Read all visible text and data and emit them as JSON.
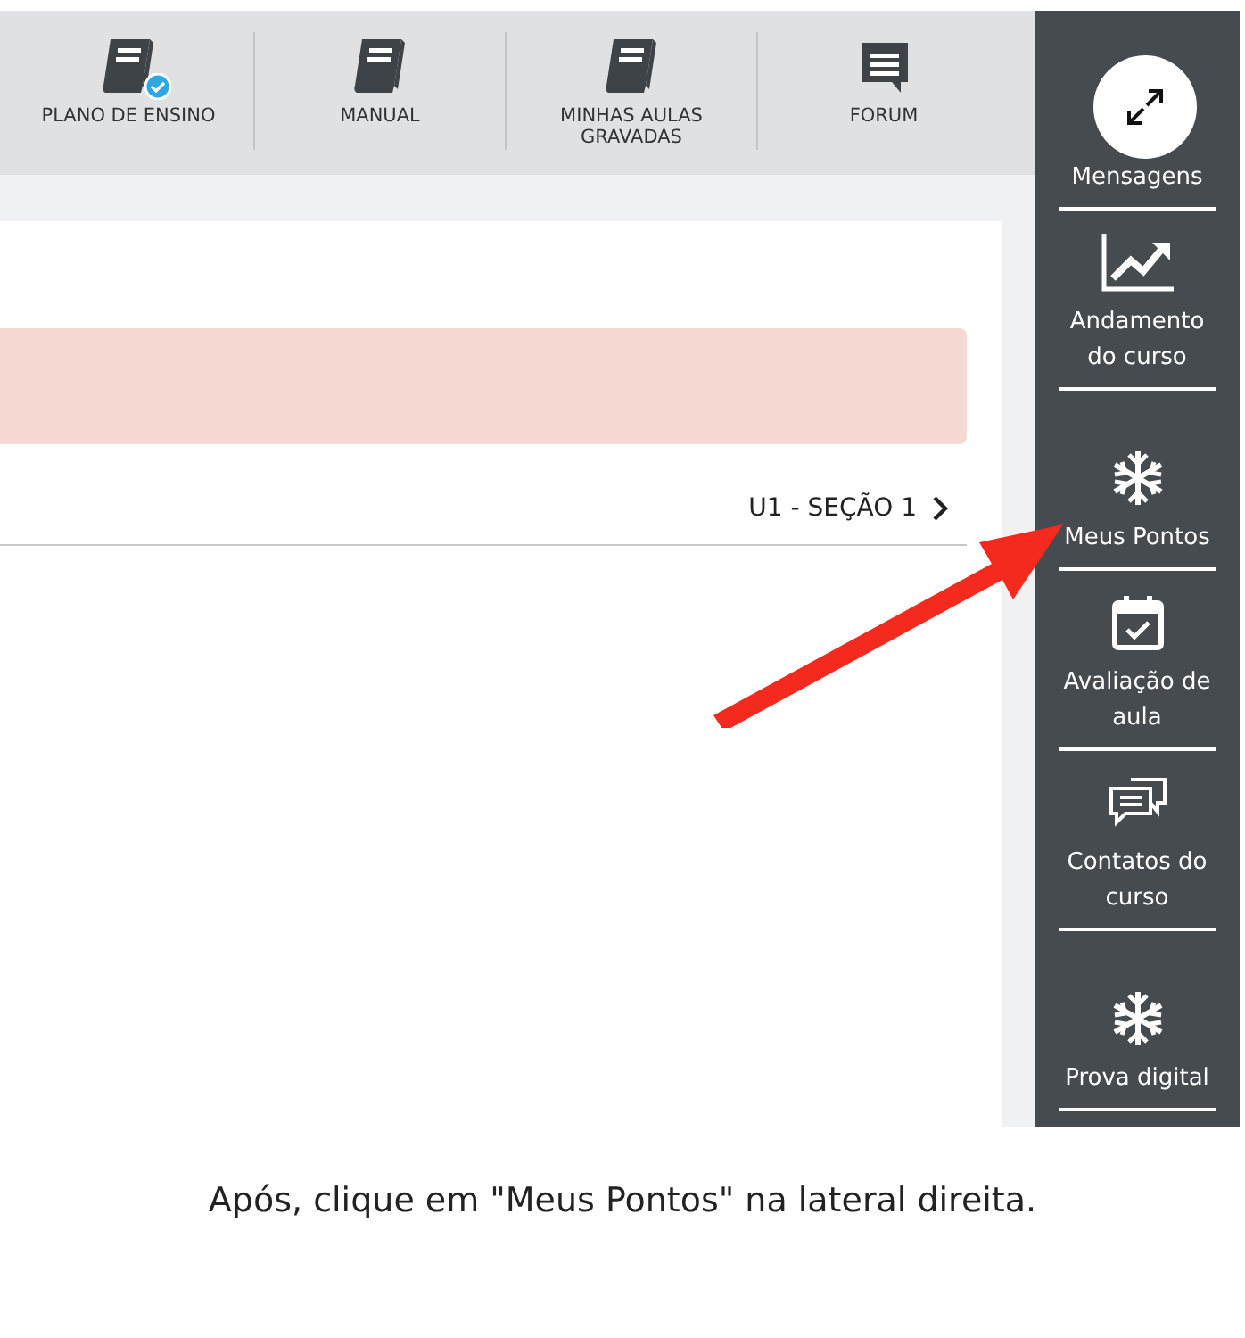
{
  "toolbar": {
    "items": [
      {
        "label": "PLANO DE ENSINO",
        "kind": "book",
        "verified": true
      },
      {
        "label": "MANUAL",
        "kind": "book",
        "verified": false
      },
      {
        "label": "MINHAS AULAS GRAVADAS",
        "kind": "book",
        "verified": false
      },
      {
        "label": "FORUM",
        "kind": "comment",
        "verified": false
      }
    ]
  },
  "content": {
    "next_link": "U1 - SEÇÃO 1"
  },
  "sidebar": {
    "items": [
      {
        "label": "Mensagens",
        "kind": "none"
      },
      {
        "label": "Andamento do curso",
        "kind": "chart"
      },
      {
        "label": "Meus Pontos",
        "kind": "snowflake"
      },
      {
        "label": "Avaliação de aula",
        "kind": "calendar"
      },
      {
        "label": "Contatos do curso",
        "kind": "chats"
      },
      {
        "label": "Prova digital",
        "kind": "snowflake"
      }
    ]
  },
  "caption": "Após, clique em \"Meus Pontos\" na lateral direita."
}
